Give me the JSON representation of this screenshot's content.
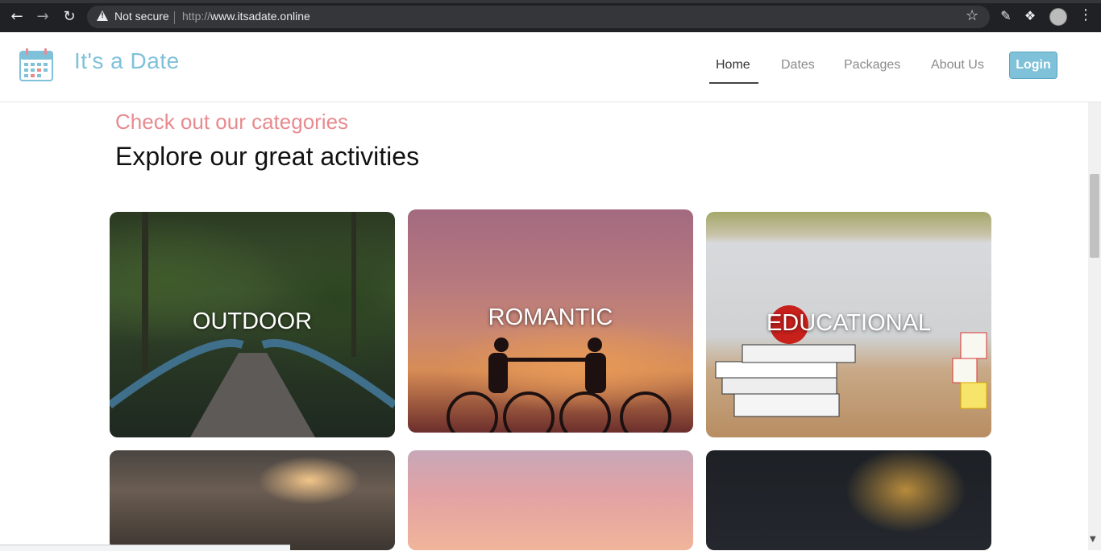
{
  "browser": {
    "security_label": "Not secure",
    "url_scheme": "http://",
    "url_host": "www.itsadate.online"
  },
  "site": {
    "brand": "It's a Date",
    "nav": [
      "Home",
      "Dates",
      "Packages",
      "About Us"
    ],
    "login_label": "Login"
  },
  "section": {
    "subtitle": "Check out our categories",
    "heading": "Explore our great activities"
  },
  "categories": [
    {
      "label": "OUTDOOR"
    },
    {
      "label": "ROMANTIC"
    },
    {
      "label": "EDUCATIONAL"
    }
  ],
  "colors": {
    "brand": "#7fc1d9",
    "accent_subtitle": "#e88a8f"
  }
}
